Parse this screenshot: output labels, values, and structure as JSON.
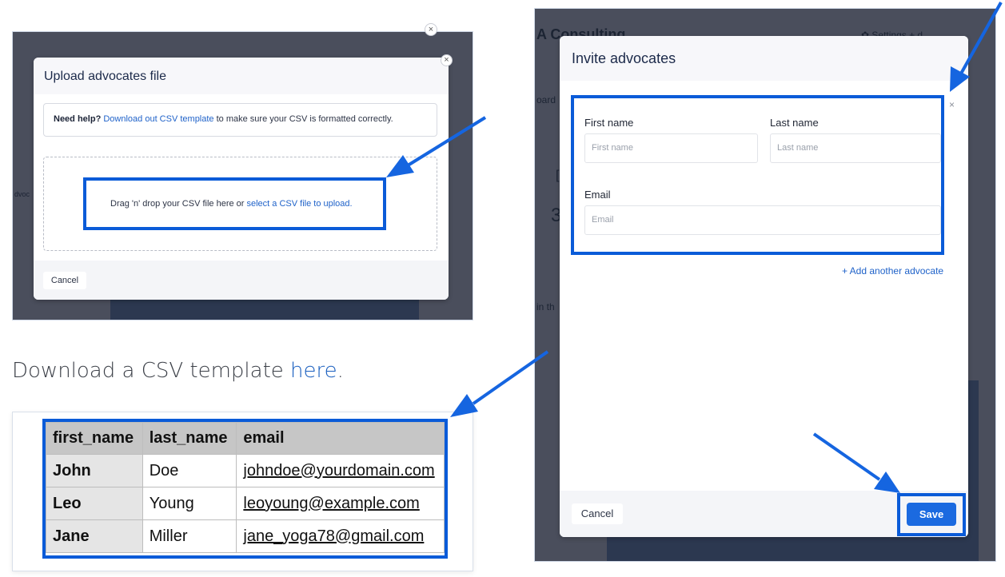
{
  "upload_modal": {
    "title": "Upload advocates file",
    "close_label": "×",
    "help_bold": "Need help?",
    "help_link": "Download out CSV template",
    "help_rest": " to make sure your CSV is formatted correctly.",
    "drop_text": "Drag 'n' drop your CSV file here or ",
    "drop_link": "select a CSV file to upload.",
    "cancel_label": "Cancel",
    "background_side_text": "dvoc"
  },
  "download_line": {
    "text": "Download a CSV template ",
    "link": "here",
    "suffix": "."
  },
  "csv_table": {
    "headers": [
      "first_name",
      "last_name",
      "email"
    ],
    "rows": [
      [
        "John",
        "Doe",
        "johndoe@yourdomain.com"
      ],
      [
        "Leo",
        "Young",
        "leoyoung@example.com"
      ],
      [
        "Jane",
        "Miller",
        "jane_yoga78@gmail.com"
      ]
    ]
  },
  "invite_modal": {
    "background_brand": "A Consulting",
    "background_settings": "✿ Settings   +  d",
    "background_side_1": "oard",
    "background_side_2": "[",
    "background_side_3": "3",
    "background_side_4": "in th",
    "title": "Invite advocates",
    "close_label": "×",
    "remove_label": "×",
    "first_name_label": "First name",
    "first_name_placeholder": "First name",
    "last_name_label": "Last name",
    "last_name_placeholder": "Last name",
    "email_label": "Email",
    "email_placeholder": "Email",
    "add_another_label": "+  Add another advocate",
    "cancel_label": "Cancel",
    "save_label": "Save"
  },
  "colors": {
    "highlight": "#0a5bd8",
    "arrow": "#1565e0",
    "link": "#1f62c9",
    "save_button": "#1b6ae0"
  }
}
